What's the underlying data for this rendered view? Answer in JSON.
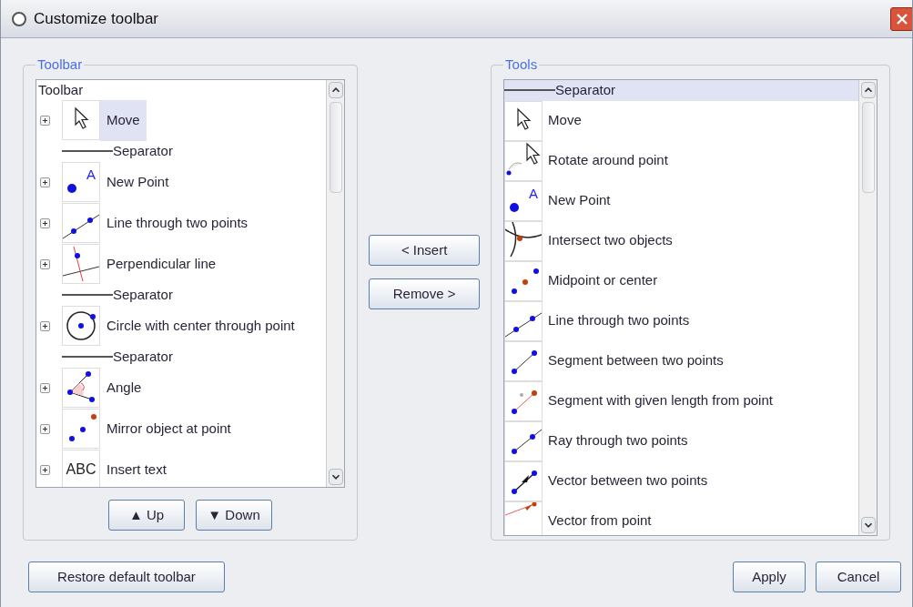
{
  "window": {
    "title": "Customize toolbar"
  },
  "toolbar_panel": {
    "legend": "Toolbar",
    "tree": {
      "root": "Toolbar",
      "items": [
        {
          "kind": "tool",
          "label": "Move",
          "selected": true,
          "expanded": false
        },
        {
          "kind": "separator",
          "label": "Separator",
          "selected": false
        },
        {
          "kind": "tool",
          "label": "New Point",
          "selected": false,
          "expanded": false,
          "icon_text": "A"
        },
        {
          "kind": "tool",
          "label": "Line through two points",
          "selected": false,
          "expanded": false
        },
        {
          "kind": "tool",
          "label": "Perpendicular line",
          "selected": false,
          "expanded": false
        },
        {
          "kind": "separator",
          "label": "Separator",
          "selected": false
        },
        {
          "kind": "tool",
          "label": "Circle with center through point",
          "selected": false,
          "expanded": false
        },
        {
          "kind": "separator",
          "label": "Separator",
          "selected": false
        },
        {
          "kind": "tool",
          "label": "Angle",
          "selected": false,
          "expanded": false
        },
        {
          "kind": "tool",
          "label": "Mirror object at point",
          "selected": false,
          "expanded": false
        },
        {
          "kind": "tool",
          "label": "Insert text",
          "selected": false,
          "expanded": false,
          "icon_text": "ABC"
        }
      ]
    },
    "buttons": [
      "▲ Up",
      "▼ Down"
    ]
  },
  "middle_buttons": [
    "< Insert",
    "Remove >"
  ],
  "tools_panel": {
    "legend": "Tools",
    "items": [
      {
        "kind": "separator",
        "label": "Separator",
        "selected": true
      },
      {
        "kind": "tool",
        "label": "Move",
        "selected": false
      },
      {
        "kind": "tool",
        "label": "Rotate around point",
        "selected": false
      },
      {
        "kind": "tool",
        "label": "New Point",
        "selected": false,
        "icon_text": "A"
      },
      {
        "kind": "tool",
        "label": "Intersect two objects",
        "selected": false
      },
      {
        "kind": "tool",
        "label": "Midpoint or center",
        "selected": false
      },
      {
        "kind": "tool",
        "label": "Line through two points",
        "selected": false
      },
      {
        "kind": "tool",
        "label": "Segment between two points",
        "selected": false
      },
      {
        "kind": "tool",
        "label": "Segment with given length from point",
        "selected": false
      },
      {
        "kind": "tool",
        "label": "Ray through two points",
        "selected": false
      },
      {
        "kind": "tool",
        "label": "Vector between two points",
        "selected": false
      },
      {
        "kind": "tool",
        "label": "Vector from point",
        "selected": false
      }
    ]
  },
  "footer": {
    "left_button": "Restore default toolbar",
    "right_buttons": [
      "Apply",
      "Cancel"
    ]
  }
}
